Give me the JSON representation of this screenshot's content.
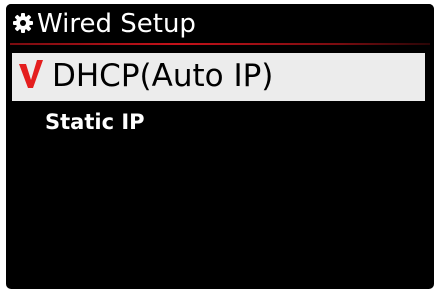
{
  "header": {
    "icon": "gear-icon",
    "title": "Wired Setup",
    "underline_color": "#c4121a"
  },
  "menu": {
    "items": [
      {
        "label": "DHCP(Auto IP)",
        "selected": true,
        "check_icon": "checkmark-icon"
      },
      {
        "label": "Static IP",
        "selected": false
      }
    ]
  },
  "colors": {
    "background": "#000000",
    "selection": "#ececec",
    "check": "#e41e1e",
    "text": "#ffffff"
  }
}
